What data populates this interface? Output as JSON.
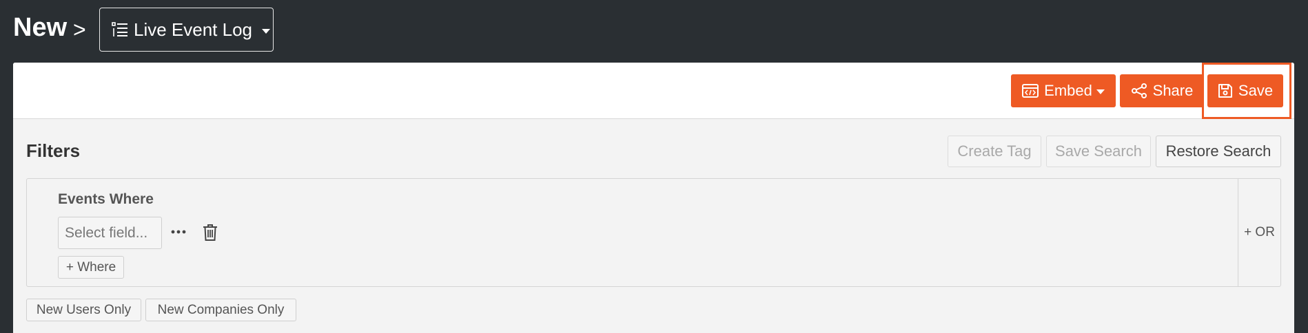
{
  "breadcrumb": {
    "title": "New",
    "separator": ">",
    "view_selector": {
      "label": "Live Event Log",
      "icon": "list-lines-icon"
    }
  },
  "toolbar": {
    "embed_label": "Embed",
    "share_label": "Share",
    "save_label": "Save",
    "accent_color": "#ee5a24"
  },
  "filters": {
    "title": "Filters",
    "create_tag_label": "Create Tag",
    "save_search_label": "Save Search",
    "restore_search_label": "Restore Search",
    "group": {
      "heading": "Events Where",
      "field_placeholder": "Select field...",
      "add_where_label": "+ Where",
      "or_label": "+ OR"
    },
    "chips": {
      "new_users": "New Users Only",
      "new_companies": "New Companies Only"
    }
  }
}
